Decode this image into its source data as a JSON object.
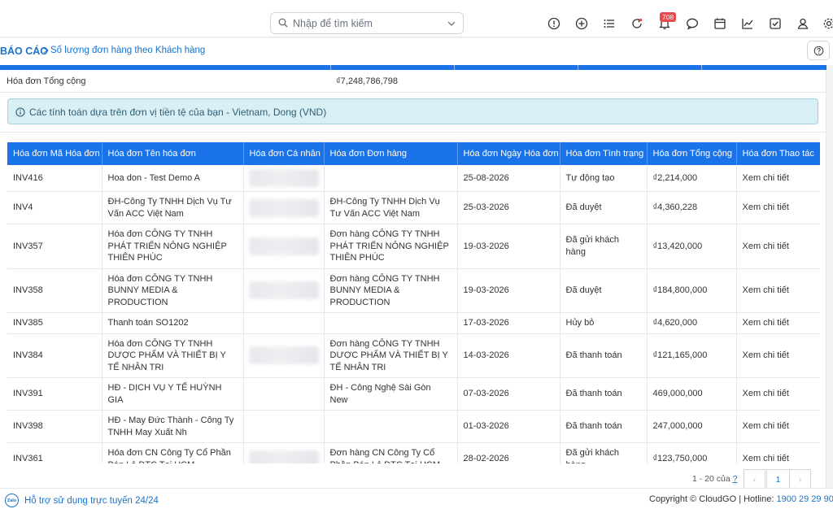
{
  "search": {
    "placeholder": "Nhập để tìm kiếm"
  },
  "toolbar": {
    "icons": [
      "alert-icon",
      "add-icon",
      "list-icon",
      "refresh-icon",
      "bell-icon",
      "chat-icon",
      "calendar-icon",
      "chart-icon",
      "checkbox-icon",
      "user-icon",
      "settings-icon"
    ],
    "notification_count": "708"
  },
  "breadcrumb": {
    "root": "BÁO CÁO",
    "separator": ">",
    "current": "Số lượng đơn hàng theo Khách hàng"
  },
  "summary": {
    "label": "Hóa đơn Tổng cộng",
    "value": "₫7,248,786,798",
    "currency_note": "Các tính toán dựa trên đơn vị tiền tệ của bạn - Vietnam, Dong (VND)"
  },
  "table": {
    "columns": [
      "Hóa đơn Mã Hóa đơn",
      "Hóa đơn Tên hóa đơn",
      "Hóa đơn Cá nhân",
      "Hóa đơn Đơn hàng",
      "Hóa đơn Ngày Hóa đơn",
      "Hóa đơn Tình trạng",
      "Hóa đơn Tổng cộng",
      "Hóa đơn Thao tác"
    ],
    "rows": [
      {
        "code": "INV416",
        "name": "Hoa don - Test Demo A",
        "person_blurred": true,
        "order": "",
        "date": "25-08-2026",
        "status": "Tự động tạo",
        "total": "₫2,214,000",
        "action": "Xem chi tiết"
      },
      {
        "code": "INV4",
        "name": "ĐH-Công Ty TNHH Dịch Vụ Tư Vấn ACC Việt Nam",
        "person_blurred": true,
        "order": "ĐH-Công Ty TNHH Dịch Vụ Tư Vấn ACC Việt Nam",
        "date": "25-03-2026",
        "status": "Đã duyệt",
        "total": "₫4,360,228",
        "action": "Xem chi tiết"
      },
      {
        "code": "INV357",
        "name": "Hóa đơn CÔNG TY TNHH PHÁT TRIỂN NÔNG NGHIỆP THIÊN PHÚC",
        "person_blurred": true,
        "order": "Đơn hàng CÔNG TY TNHH PHÁT TRIỂN NÔNG NGHIỆP THIÊN PHÚC",
        "date": "19-03-2026",
        "status": "Đã gửi khách hàng",
        "total": "₫13,420,000",
        "action": "Xem chi tiết"
      },
      {
        "code": "INV358",
        "name": "Hóa đơn CÔNG TY TNHH BUNNY MEDIA & PRODUCTION",
        "person_blurred": true,
        "order": "Đơn hàng CÔNG TY TNHH BUNNY MEDIA & PRODUCTION",
        "date": "19-03-2026",
        "status": "Đã duyệt",
        "total": "₫184,800,000",
        "action": "Xem chi tiết"
      },
      {
        "code": "INV385",
        "name": "Thanh toán SO1202",
        "person_blurred": false,
        "order": "",
        "date": "17-03-2026",
        "status": "Hủy bỏ",
        "total": "₫4,620,000",
        "action": "Xem chi tiết"
      },
      {
        "code": "INV384",
        "name": "Hóa đơn CÔNG TY TNHH DƯỢC PHẨM VÀ THIẾT BỊ Y TẾ NHÂN TRI",
        "person_blurred": true,
        "order": "Đơn hàng CÔNG TY TNHH DƯỢC PHẨM VÀ THIẾT BỊ Y TẾ NHÂN TRI",
        "date": "14-03-2026",
        "status": "Đã thanh toán",
        "total": "₫121,165,000",
        "action": "Xem chi tiết"
      },
      {
        "code": "INV391",
        "name": "HĐ - DỊCH VỤ Y TẾ HUỲNH GIA",
        "person_blurred": false,
        "order": "ĐH - Công Nghệ Sài Gòn New",
        "date": "07-03-2026",
        "status": "Đã thanh toán",
        "total": "469,000,000",
        "action": "Xem chi tiết"
      },
      {
        "code": "INV398",
        "name": "HĐ - May Đức Thành - Công Ty TNHH May Xuất Nh",
        "person_blurred": false,
        "order": "",
        "date": "01-03-2026",
        "status": "Đã thanh toán",
        "total": "247,000,000",
        "action": "Xem chi tiết"
      },
      {
        "code": "INV361",
        "name": "Hóa đơn CN Công Ty Cổ Phần Bán Lẻ DTC Tại HCM",
        "person_blurred": true,
        "order": "Đơn hàng CN Công Ty Cổ Phần Bán Lẻ DTC Tại HCM",
        "date": "28-02-2026",
        "status": "Đã gửi khách hàng",
        "total": "₫123,750,000",
        "action": "Xem chi tiết"
      }
    ]
  },
  "pagination": {
    "range_text": "1 - 20 của",
    "total_link": "?",
    "current_page": "1",
    "prev": "‹",
    "next": "›"
  },
  "footer": {
    "zalo_label": "Zalo",
    "support_text": "Hỗ trợ sử dụng trực tuyến 24/24",
    "copyright": "Copyright © CloudGO | Hotline: ",
    "hotline": "1900 29 29 90"
  },
  "colors": {
    "accent": "#1a73e8",
    "link": "#1a73c9",
    "info_bg": "#d9eff6",
    "badge": "#e5484d"
  }
}
